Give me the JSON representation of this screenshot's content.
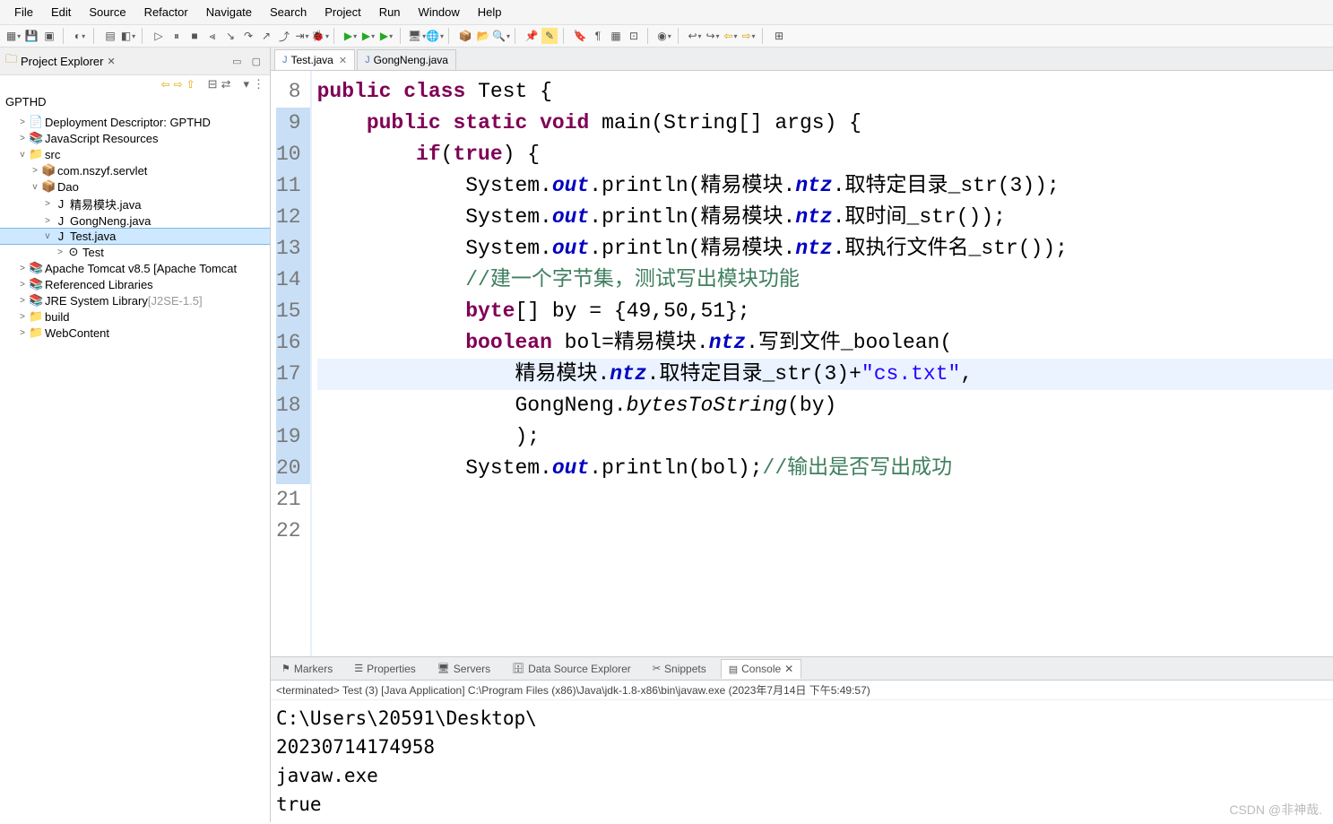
{
  "menu": [
    "File",
    "Edit",
    "Source",
    "Refactor",
    "Navigate",
    "Search",
    "Project",
    "Run",
    "Window",
    "Help"
  ],
  "projectExplorer": {
    "title": "Project Explorer",
    "root": "GPTHD",
    "nodes": [
      {
        "tw": ">",
        "ic": "📄",
        "label": "Deployment Descriptor: GPTHD",
        "ind": 1
      },
      {
        "tw": ">",
        "ic": "📚",
        "label": "JavaScript Resources",
        "ind": 1
      },
      {
        "tw": "v",
        "ic": "📁",
        "label": "src",
        "ind": 1
      },
      {
        "tw": ">",
        "ic": "📦",
        "label": "com.nszyf.servlet",
        "ind": 2
      },
      {
        "tw": "v",
        "ic": "📦",
        "label": "Dao",
        "ind": 2
      },
      {
        "tw": ">",
        "ic": "J",
        "label": "精易模块.java",
        "ind": 3
      },
      {
        "tw": ">",
        "ic": "J",
        "label": "GongNeng.java",
        "ind": 3
      },
      {
        "tw": "v",
        "ic": "J",
        "label": "Test.java",
        "ind": 3,
        "sel": true
      },
      {
        "tw": ">",
        "ic": "⊙",
        "label": "Test",
        "ind": 4
      },
      {
        "tw": ">",
        "ic": "📚",
        "label": "Apache Tomcat v8.5 [Apache Tomcat",
        "ind": 1
      },
      {
        "tw": ">",
        "ic": "📚",
        "label": "Referenced Libraries",
        "ind": 1
      },
      {
        "tw": ">",
        "ic": "📚",
        "label": "JRE System Library ",
        "suffix": "[J2SE-1.5]",
        "ind": 1
      },
      {
        "tw": ">",
        "ic": "📁",
        "label": "build",
        "ind": 1
      },
      {
        "tw": ">",
        "ic": "📁",
        "label": "WebContent",
        "ind": 1
      }
    ]
  },
  "editorTabs": [
    {
      "label": "Test.java",
      "active": true
    },
    {
      "label": "GongNeng.java",
      "active": false
    }
  ],
  "lineNumbers": [
    "8",
    "9",
    "10",
    "11",
    "12",
    "13",
    "14",
    "15",
    "16",
    "17",
    "18",
    "19",
    "20",
    "21",
    "22"
  ],
  "highlightLine": 17,
  "code": {
    "l8": {
      "pre": "",
      "kw1": "public",
      "sp1": " ",
      "kw2": "class",
      "sp2": " Test {"
    },
    "l9": {
      "pre": "    ",
      "kw1": "public",
      "sp1": " ",
      "kw2": "static",
      "sp2": " ",
      "kw3": "void",
      "sp3": " main(String[] args) {"
    },
    "l10": {
      "pre": "        ",
      "kw1": "if",
      "post": "(",
      "kw2": "true",
      "post2": ") {"
    },
    "l11": {
      "pre": "            System.",
      "fld": "out",
      "post": ".println(精易模块.",
      "fld2": "ntz",
      "post2": ".取特定目录_str(3));"
    },
    "l12": {
      "pre": "            System.",
      "fld": "out",
      "post": ".println(精易模块.",
      "fld2": "ntz",
      "post2": ".取时间_str());"
    },
    "l13": {
      "pre": "            System.",
      "fld": "out",
      "post": ".println(精易模块.",
      "fld2": "ntz",
      "post2": ".取执行文件名_str());"
    },
    "l14": {
      "pre": "            ",
      "cmt": "//建一个字节集，测试写出模块功能"
    },
    "l15": {
      "pre": "            ",
      "kw": "byte",
      "post": "[] by = {49,50,51};"
    },
    "l16": {
      "pre": "            ",
      "kw": "boolean",
      "post": " bol=精易模块.",
      "fld": "ntz",
      "post2": ".写到文件_boolean("
    },
    "l17": {
      "pre": "                精易模块.",
      "fld": "ntz",
      "post": ".取特定目录_str(3)+",
      "str": "\"cs.txt\"",
      "post2": ","
    },
    "l18": {
      "pre": "                GongNeng.",
      "mth": "bytesToString",
      "post": "(by)"
    },
    "l19": {
      "pre": "                );"
    },
    "l20": {
      "pre": "            System.",
      "fld": "out",
      "post": ".println(bol);",
      "cmt": "//输出是否写出成功"
    },
    "l21": "",
    "l22": ""
  },
  "bottomTabs": [
    "Markers",
    "Properties",
    "Servers",
    "Data Source Explorer",
    "Snippets",
    "Console"
  ],
  "terminated": "<terminated> Test (3) [Java Application] C:\\Program Files (x86)\\Java\\jdk-1.8-x86\\bin\\javaw.exe (2023年7月14日 下午5:49:57)",
  "consoleLines": [
    "C:\\Users\\20591\\Desktop\\",
    "20230714174958",
    "javaw.exe",
    "true"
  ],
  "watermark": "CSDN @非神哉."
}
